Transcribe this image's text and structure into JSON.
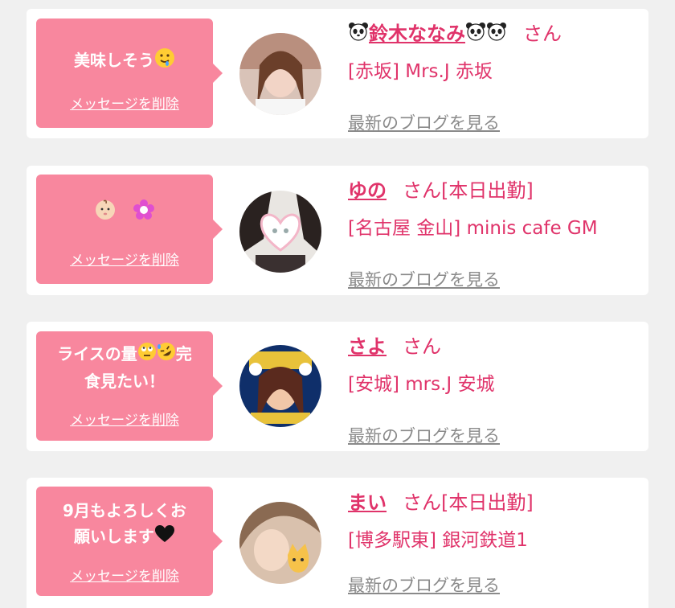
{
  "colors": {
    "background": "#f0f0f0",
    "bubble": "#f8879e",
    "name": "#e0336a",
    "blog_link": "#8a8a8a"
  },
  "messages": [
    {
      "bubble_lines": [
        "美味しそう"
      ],
      "bubble_emojis": [
        "drooling-face"
      ],
      "delete_label": "メッセージを削除",
      "name": "鈴木ななみ",
      "name_prefix_icons": [
        "panda-face"
      ],
      "name_suffix_icons": [
        "panda-face",
        "panda-face"
      ],
      "honorific": "さん",
      "status": "",
      "shop": "[赤坂] Mrs.J 赤坂",
      "blog_label": "最新のブログを見る"
    },
    {
      "bubble_lines": [
        ""
      ],
      "bubble_emojis": [
        "baby-face",
        "flower"
      ],
      "delete_label": "メッセージを削除",
      "name": "ゆの",
      "honorific": "さん",
      "status": "[本日出勤]",
      "shop": "[名古屋 金山] minis cafe GM",
      "blog_label": "最新のブログを見る"
    },
    {
      "bubble_lines": [
        "ライスの量",
        "完",
        "食見たい！"
      ],
      "bubble_emojis": [
        "rolling-eyes-face",
        "rofl-face"
      ],
      "delete_label": "メッセージを削除",
      "name": "さよ",
      "honorific": "さん",
      "status": "",
      "shop": "[安城] mrs.J 安城",
      "blog_label": "最新のブログを見る"
    },
    {
      "bubble_lines": [
        "9月もよろしくお",
        "願いします"
      ],
      "bubble_emojis": [
        "black-heart"
      ],
      "delete_label": "メッセージを削除",
      "name": "まい",
      "honorific": "さん",
      "status": "[本日出勤]",
      "shop": "[博多駅東] 銀河鉄道1",
      "blog_label": "最新のブログを見る"
    }
  ]
}
